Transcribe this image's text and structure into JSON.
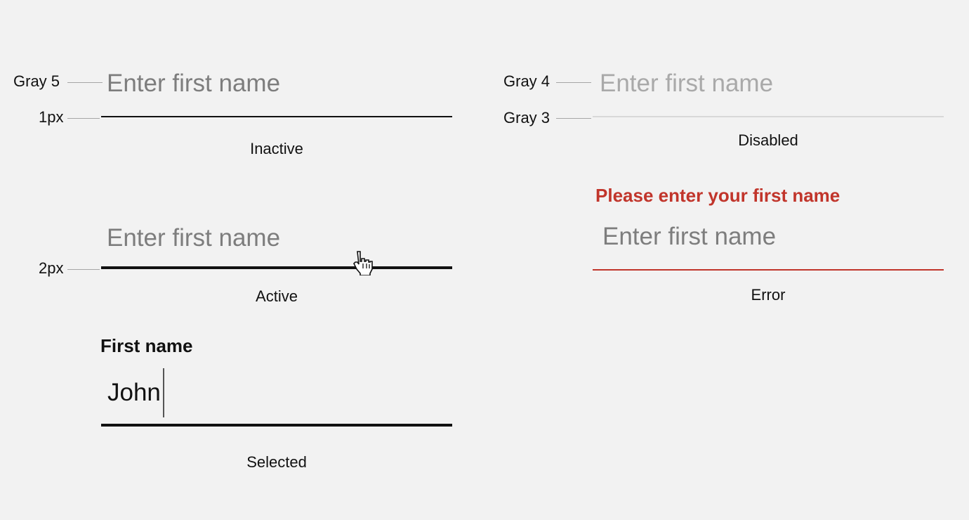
{
  "annotations": {
    "gray5": "Gray 5",
    "line_1px": "1px",
    "line_2px": "2px",
    "gray4": "Gray 4",
    "gray3": "Gray 3"
  },
  "fields": {
    "inactive": {
      "placeholder": "Enter first name",
      "caption": "Inactive"
    },
    "active": {
      "placeholder": "Enter first name",
      "caption": "Active"
    },
    "selected": {
      "label": "First name",
      "value": "John",
      "caption": "Selected"
    },
    "disabled": {
      "placeholder": "Enter first name",
      "caption": "Disabled"
    },
    "error": {
      "message": "Please enter your first name",
      "placeholder": "Enter first name",
      "caption": "Error"
    }
  },
  "colors": {
    "gray5": "#7d7d7d",
    "gray4": "#a9a9a9",
    "gray3": "#d8d8d8",
    "error": "#c1352b",
    "background": "#f2f2f2"
  },
  "cursor": "hand-pointer-icon"
}
